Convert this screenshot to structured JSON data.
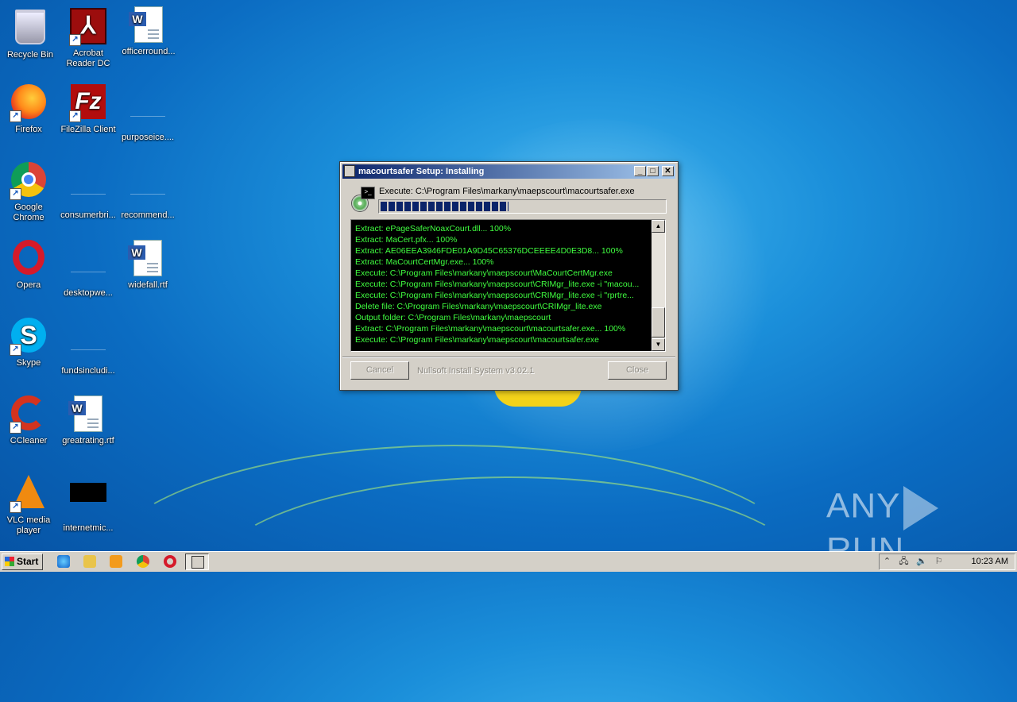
{
  "desktop": {
    "icons": [
      {
        "label": "Recycle Bin",
        "icon": "recycle-bin-icon"
      },
      {
        "label": "Acrobat Reader DC",
        "icon": "acrobat-reader-icon"
      },
      {
        "label": "officerround...",
        "icon": "word-document-icon"
      },
      {
        "label": "Firefox",
        "icon": "firefox-icon"
      },
      {
        "label": "FileZilla Client",
        "icon": "filezilla-icon"
      },
      {
        "label": "purposeice....",
        "icon": "blank-file-icon"
      },
      {
        "label": "Google Chrome",
        "icon": "chrome-icon"
      },
      {
        "label": "consumerbri...",
        "icon": "blank-file-icon"
      },
      {
        "label": "recommend...",
        "icon": "blank-file-icon"
      },
      {
        "label": "Opera",
        "icon": "opera-icon"
      },
      {
        "label": "desktopwe...",
        "icon": "blank-file-icon"
      },
      {
        "label": "widefall.rtf",
        "icon": "word-document-icon"
      },
      {
        "label": "Skype",
        "icon": "skype-icon"
      },
      {
        "label": "fundsincludi...",
        "icon": "blank-file-icon"
      },
      {
        "label": "CCleaner",
        "icon": "ccleaner-icon"
      },
      {
        "label": "greatrating.rtf",
        "icon": "word-document-icon"
      },
      {
        "label": "VLC media player",
        "icon": "vlc-icon"
      },
      {
        "label": "internetmic...",
        "icon": "black-file-icon"
      }
    ]
  },
  "installer": {
    "title": "macourtsafer Setup: Installing",
    "status": "Execute: C:\\Program Files\\markany\\maepscourt\\macourtsafer.exe",
    "progress_fraction": 0.45,
    "log": [
      "Extract: ePageSaferNoaxCourt.dll... 100%",
      "Extract: MaCert.pfx... 100%",
      "Extract: AE06EEA3946FDE01A9D45C65376DCEEEE4D0E3D8... 100%",
      "Extract: MaCourtCertMgr.exe... 100%",
      "Execute: C:\\Program Files\\markany\\maepscourt\\MaCourtCertMgr.exe",
      "Execute: C:\\Program Files\\markany\\maepscourt\\CRIMgr_lite.exe -i \"macou...",
      "Execute: C:\\Program Files\\markany\\maepscourt\\CRIMgr_lite.exe -i \"rprtre...",
      "Delete file: C:\\Program Files\\markany\\maepscourt\\CRIMgr_lite.exe",
      "Output folder: C:\\Program Files\\markany\\maepscourt",
      "Extract: C:\\Program Files\\markany\\maepscourt\\macourtsafer.exe... 100%",
      "Execute: C:\\Program Files\\markany\\maepscourt\\macourtsafer.exe"
    ],
    "cancel_label": "Cancel",
    "branding": "Nullsoft Install System v3.02.1",
    "close_label": "Close",
    "minimize_glyph": "_",
    "maximize_glyph": "□",
    "close_glyph": "✕"
  },
  "watermark": {
    "left": "ANY",
    "right": "RUN"
  },
  "taskbar": {
    "start_label": "Start",
    "clock": "10:23 AM",
    "quicklaunch": [
      "ie-icon",
      "explorer-icon",
      "media-player-icon",
      "chrome-icon",
      "opera-icon"
    ]
  }
}
